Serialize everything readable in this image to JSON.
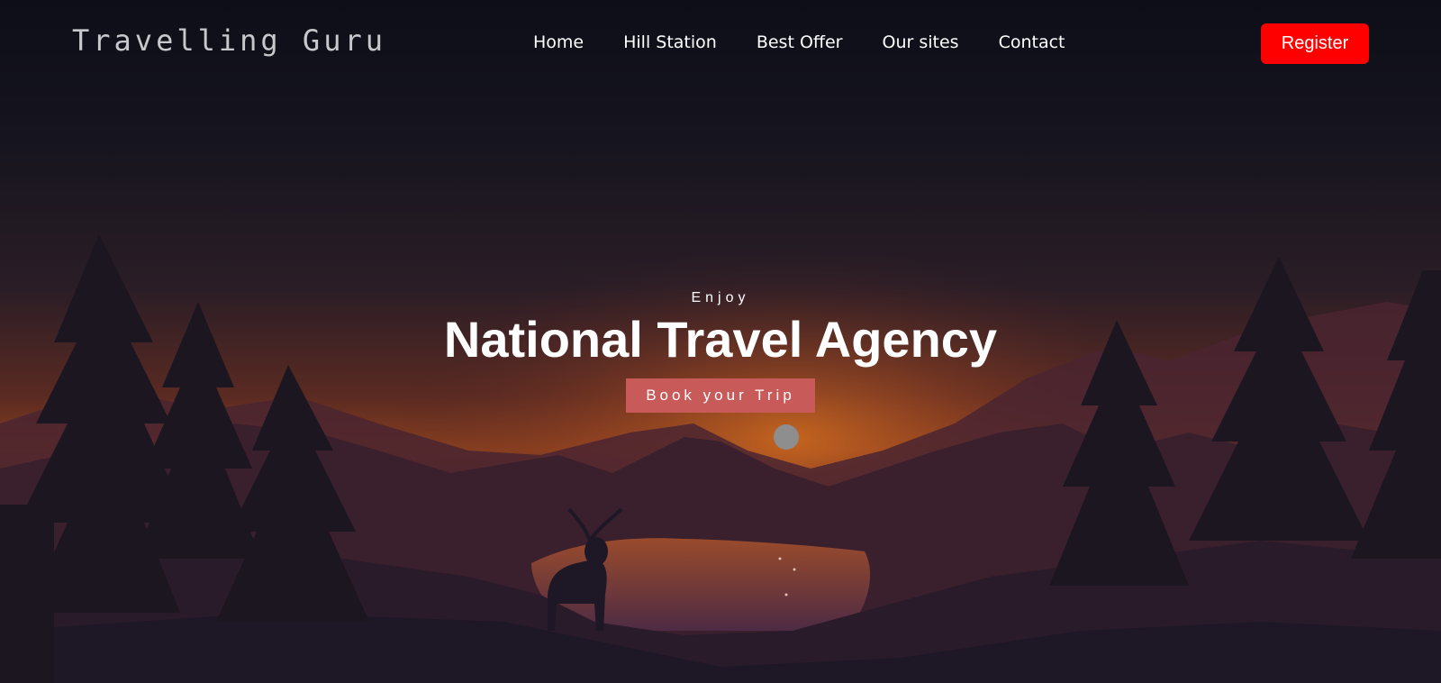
{
  "brand": {
    "name": "Travelling Guru"
  },
  "nav": {
    "items": [
      {
        "label": "Home"
      },
      {
        "label": "Hill Station"
      },
      {
        "label": "Best Offer"
      },
      {
        "label": "Our sites"
      },
      {
        "label": "Contact"
      }
    ]
  },
  "header": {
    "register_label": "Register"
  },
  "hero": {
    "kicker": "Enjoy",
    "title": "National Travel Agency",
    "cta_label": "Book your Trip"
  },
  "colors": {
    "register_bg": "#ff0000",
    "cta_bg": "#c85a5a",
    "sky_top": "#0d0e18",
    "horizon_glow": "#b3561f"
  }
}
